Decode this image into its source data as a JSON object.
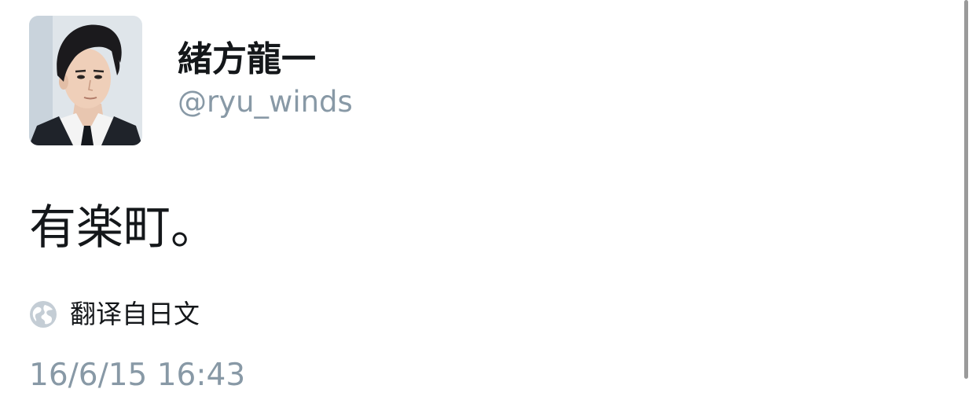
{
  "user": {
    "display_name": "緒方龍一",
    "handle": "@ryu_winds"
  },
  "tweet": {
    "text": "有楽町。",
    "translate_label": "翻译自日文",
    "timestamp": "16/6/15 16:43"
  },
  "icons": {
    "translate": "globe-icon",
    "avatar": "profile-photo"
  },
  "colors": {
    "text": "#14171a",
    "secondary": "#8899a6",
    "background": "#ffffff"
  }
}
